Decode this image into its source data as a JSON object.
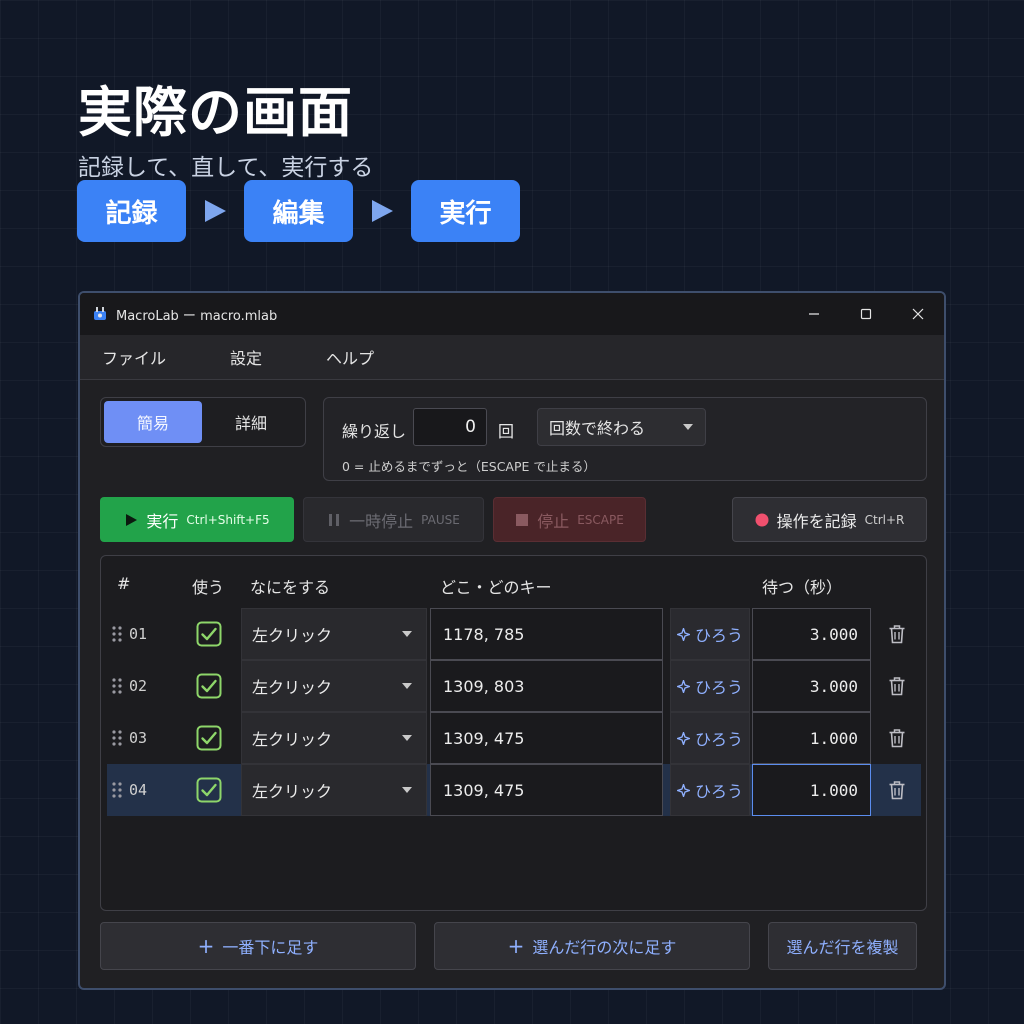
{
  "hero": {
    "title": "実際の画面",
    "subtitle": "記録して、直して、実行する",
    "steps": [
      "記録",
      "編集",
      "実行"
    ]
  },
  "window": {
    "title": "MacroLab ー macro.mlab"
  },
  "menu": [
    "ファイル",
    "設定",
    "ヘルプ"
  ],
  "mode": {
    "simple": "簡易",
    "detail": "詳細",
    "active": "simple"
  },
  "repeat": {
    "label": "繰り返し",
    "count": "0",
    "unit": "回",
    "mode": "回数で終わる",
    "note": "0 = 止めるまでずっと（ESCAPE で止まる）"
  },
  "controls": {
    "run": {
      "label": "実行",
      "shortcut": "Ctrl+Shift+F5"
    },
    "pause": {
      "label": "一時停止",
      "shortcut": "PAUSE"
    },
    "stop": {
      "label": "停止",
      "shortcut": "ESCAPE"
    },
    "record": {
      "label": "操作を記録",
      "shortcut": "Ctrl+R"
    }
  },
  "table": {
    "headers": {
      "num": "#",
      "use": "使う",
      "action": "なにをする",
      "where": "どこ・どのキー",
      "wait": "待つ（秒）"
    },
    "pick_label": "ひろう",
    "rows": [
      {
        "num": "01",
        "use": true,
        "action": "左クリック",
        "where": "1178, 785",
        "wait": "3.000"
      },
      {
        "num": "02",
        "use": true,
        "action": "左クリック",
        "where": "1309, 803",
        "wait": "3.000"
      },
      {
        "num": "03",
        "use": true,
        "action": "左クリック",
        "where": "1309, 475",
        "wait": "1.000"
      },
      {
        "num": "04",
        "use": true,
        "action": "左クリック",
        "where": "1309, 475",
        "wait": "1.000",
        "selected": true
      }
    ]
  },
  "bottom": {
    "add_bottom": "一番下に足す",
    "add_after": "選んだ行の次に足す",
    "duplicate": "選んだ行を複製"
  },
  "colors": {
    "accent": "#3b82f6",
    "run": "#22a34a",
    "record_dot": "#f0506e",
    "link": "#8fb0ff"
  }
}
